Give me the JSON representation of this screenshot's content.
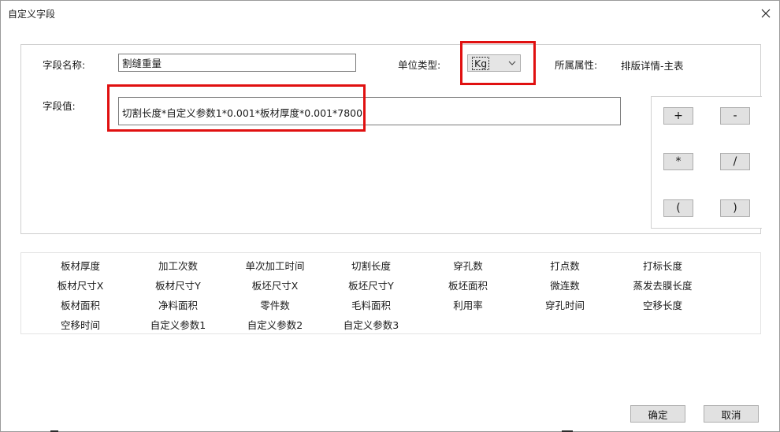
{
  "dialog": {
    "title": "自定义字段",
    "close_glyph": "✕"
  },
  "form": {
    "field_name_label": "字段名称:",
    "field_name_value": "割缝重量",
    "unit_type_label": "单位类型:",
    "unit_type_value": "Kg",
    "attribute_label": "所属属性:",
    "attribute_value": "排版详情-主表",
    "field_value_label": "字段值:",
    "field_value_expression": "切割长度*自定义参数1*0.001*板材厚度*0.001*7800"
  },
  "operators": [
    "+",
    "-",
    "*",
    "/",
    "(",
    ")"
  ],
  "fields": {
    "rows": [
      [
        "板材厚度",
        "加工次数",
        "单次加工时间",
        "切割长度",
        "穿孔数",
        "打点数",
        "打标长度"
      ],
      [
        "板材尺寸X",
        "板材尺寸Y",
        "板坯尺寸X",
        "板坯尺寸Y",
        "板坯面积",
        "微连数",
        "蒸发去膜长度"
      ],
      [
        "板材面积",
        "净料面积",
        "零件数",
        "毛料面积",
        "利用率",
        "穿孔时间",
        "空移长度"
      ],
      [
        "空移时间",
        "自定义参数1",
        "自定义参数2",
        "自定义参数3"
      ]
    ]
  },
  "buttons": {
    "ok": "确定",
    "cancel": "取消"
  },
  "highlight_color": "#e01010"
}
